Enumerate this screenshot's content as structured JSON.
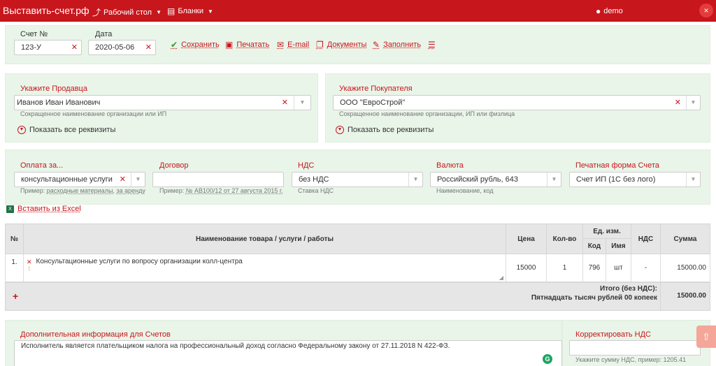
{
  "navbar": {
    "brand": "Выставить-счет.рф",
    "desktop": "Рабочий стол",
    "forms": "Бланки",
    "user": "demo",
    "close_glyph": "×"
  },
  "invoice": {
    "number_label": "Счет №",
    "number_value": "123-У",
    "date_label": "Дата",
    "date_value": "2020-05-06"
  },
  "toolbar": {
    "save": "Сохранить",
    "print": "Печатать",
    "email": "E-mail",
    "documents": "Документы",
    "fill": "Заполнить"
  },
  "seller": {
    "label": "Укажите Продавца",
    "value": "Иванов Иван Иванович",
    "hint": "Сокращенное наименование организации или ИП",
    "show_all": "Показать все реквизиты"
  },
  "buyer": {
    "label": "Укажите Покупателя",
    "value": "ООО \"ЕвроСтрой\"",
    "hint": "Сокращенное наименование организации, ИП или физлица",
    "show_all": "Показать все реквизиты"
  },
  "payment": {
    "label": "Оплата за...",
    "value": "консультационные услуги",
    "hint_prefix": "Пример:",
    "hint_example1": "расходные материалы",
    "hint_sep": ",",
    "hint_example2": "за аренду"
  },
  "contract": {
    "label": "Договор",
    "value": "",
    "hint_prefix": "Пример:",
    "hint_example": "№ АВ100/12 от 27 августа 2015 г."
  },
  "vat": {
    "label": "НДС",
    "value": "без НДС",
    "hint": "Ставка НДС"
  },
  "currency": {
    "label": "Валюта",
    "value": "Российский рубль, 643",
    "hint": "Наименование, код"
  },
  "print_form": {
    "label": "Печатная форма Счета",
    "value": "Счет ИП (1С без лого)"
  },
  "paste_excel": "Вставить из Excel",
  "table": {
    "headers": {
      "num": "№",
      "name": "Наименование товара / услуги / работы",
      "price": "Цена",
      "qty": "Кол-во",
      "unit": "Ед. изм.",
      "unit_code": "Код",
      "unit_name": "Имя",
      "vat": "НДС",
      "sum": "Сумма"
    },
    "rows": [
      {
        "num": "1.",
        "name": "Консультационные услуги по вопросу организации колл-центра",
        "price": "15000",
        "qty": "1",
        "code": "796",
        "unit": "шт",
        "vat": "-",
        "sum": "15000.00"
      }
    ],
    "add_glyph": "+",
    "total_label": "Итого (без НДС):",
    "total_words": "Пятнадцать тысяч рублей 00 копеек",
    "total_value": "15000.00"
  },
  "additional": {
    "label": "Дополнительная информация для Счетов",
    "text": "Исполнитель является плательщиком налога на профессиональный доход согласно Федеральному закону от 27.11.2018 N 422-ФЗ."
  },
  "vat_adjust": {
    "label": "Корректировать НДС",
    "hint": "Укажите сумму НДС, пример: 1205.41"
  },
  "colors": {
    "brand_red": "#c8161d",
    "panel_green": "#e9f5e9",
    "header_grey": "#e6e6e6"
  }
}
